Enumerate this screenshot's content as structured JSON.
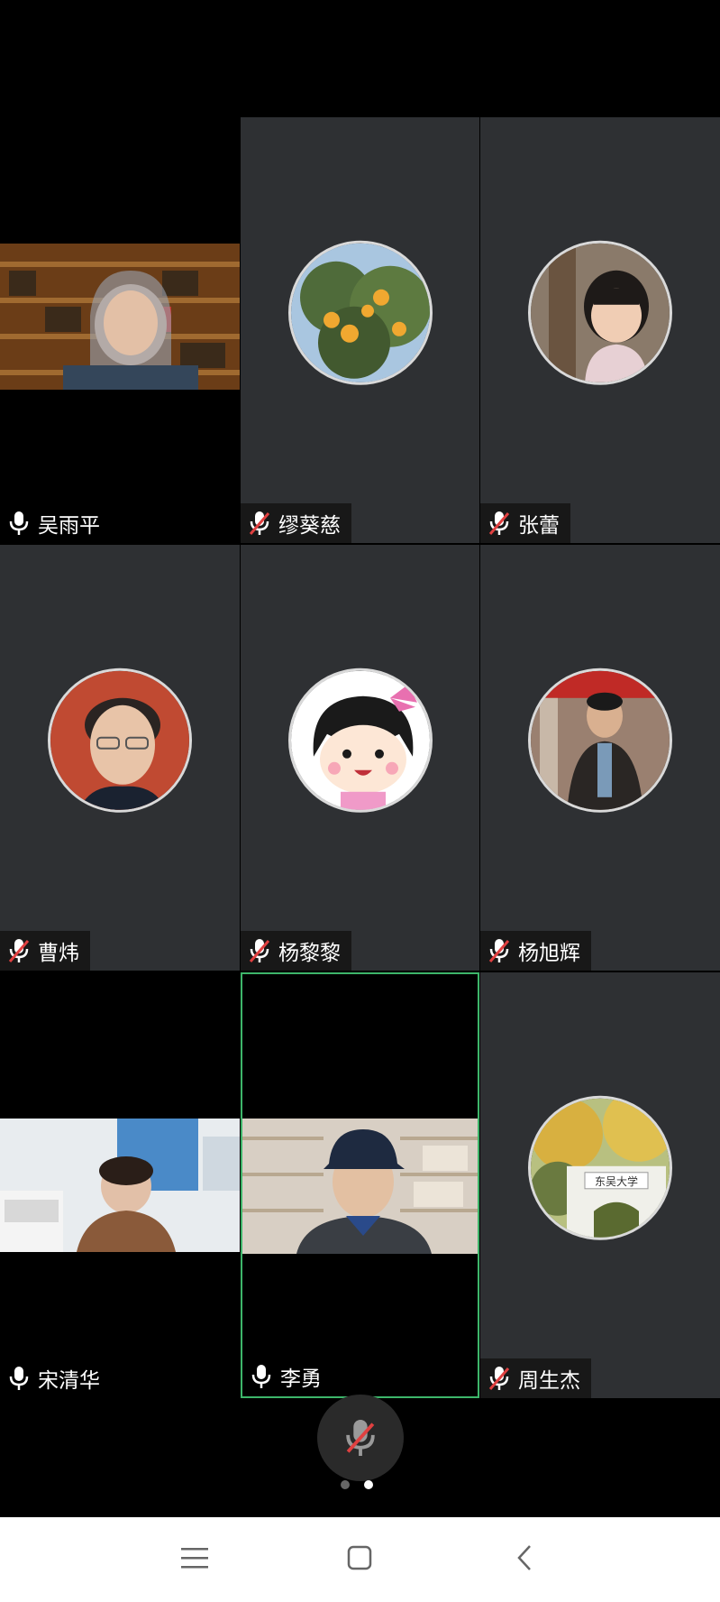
{
  "participants": [
    {
      "name": "吴雨平",
      "muted": false,
      "media": "video",
      "video_scene": "bookshelf-woman-glasses"
    },
    {
      "name": "缪葵慈",
      "muted": true,
      "media": "avatar",
      "avatar_scene": "orange-tree"
    },
    {
      "name": "张蕾",
      "muted": true,
      "media": "avatar",
      "avatar_scene": "girl-portrait"
    },
    {
      "name": "曹炜",
      "muted": true,
      "media": "avatar",
      "avatar_scene": "man-glasses-red-bg"
    },
    {
      "name": "杨黎黎",
      "muted": true,
      "media": "avatar",
      "avatar_scene": "cartoon-girl"
    },
    {
      "name": "杨旭辉",
      "muted": true,
      "media": "avatar",
      "avatar_scene": "man-speaking"
    },
    {
      "name": "宋清华",
      "muted": false,
      "media": "video",
      "video_scene": "office-woman"
    },
    {
      "name": "李勇",
      "muted": false,
      "media": "video",
      "video_scene": "man-cap-bookshelf",
      "active_speaker": true
    },
    {
      "name": "周生杰",
      "muted": true,
      "media": "avatar",
      "avatar_scene": "university-gate",
      "avatar_text": "东吴大学"
    }
  ],
  "controls": {
    "main_mic": "mic-muted-icon"
  },
  "pagination": {
    "pages": 2,
    "current": 2
  },
  "nav": {
    "icons": [
      "menu-icon",
      "home-square-icon",
      "back-chevron-icon"
    ]
  },
  "colors": {
    "tile_bg": "#2e3033",
    "active_border": "#3db56a",
    "muted_slash": "#e04040"
  }
}
